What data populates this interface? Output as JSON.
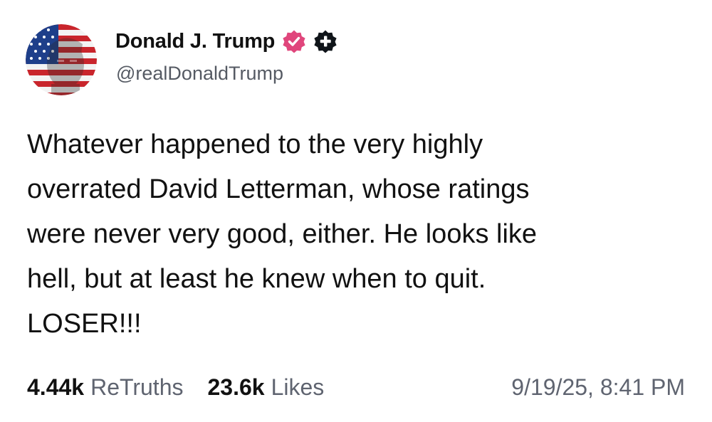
{
  "author": {
    "display_name": "Donald J. Trump",
    "handle": "@realDonaldTrump",
    "avatar": "profile-photo-with-american-flag-overlay"
  },
  "badges": [
    {
      "name": "verified-badge-icon",
      "color": "#e0467c"
    },
    {
      "name": "plus-badge-icon",
      "color": "#0f1419"
    }
  ],
  "post": {
    "text": "Whatever happened to the very highly\noverrated David Letterman, whose ratings\nwere never very good, either. He looks like\nhell, but at least he knew when to quit.\nLOSER!!!"
  },
  "stats": {
    "retruths_count": "4.44k",
    "retruths_label": "ReTruths",
    "likes_count": "23.6k",
    "likes_label": "Likes"
  },
  "timestamp": "9/19/25, 8:41 PM",
  "colors": {
    "text_primary": "#111111",
    "text_secondary": "#5f6470",
    "verified_badge": "#e0467c"
  }
}
